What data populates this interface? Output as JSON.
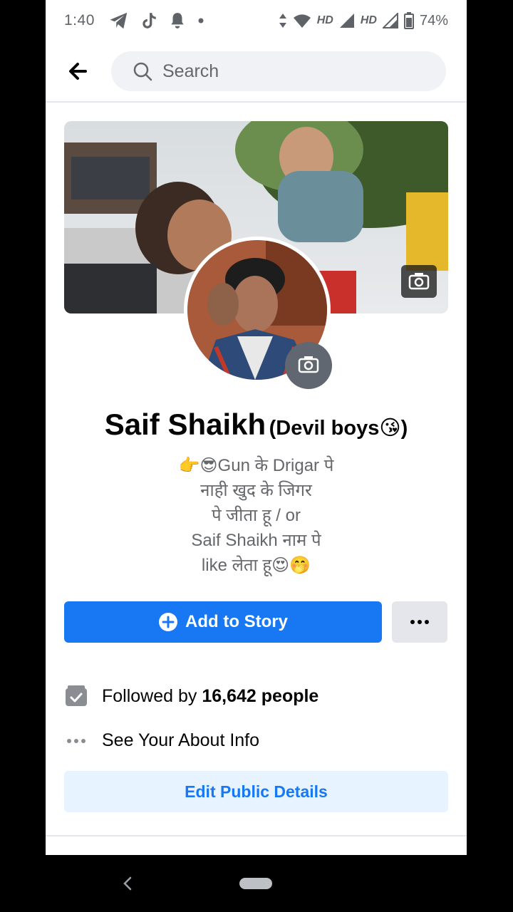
{
  "status_bar": {
    "time": "1:40",
    "hd1": "HD",
    "hd2": "HD",
    "battery": "74%"
  },
  "header": {
    "search_placeholder": "Search"
  },
  "profile": {
    "name": "Saif Shaikh",
    "alternate_name": "(Devil boys😘)",
    "bio_lines": [
      "👉😎Gun के Drigar पे",
      "नाही खुद के जिगर",
      "पे जीता हू / or",
      "Saif Shaikh नाम पे",
      "like लेता हू😍🤭"
    ]
  },
  "actions": {
    "add_story_label": "Add to Story",
    "more_label": "···"
  },
  "info": {
    "followed_prefix": "Followed by ",
    "followed_count": "16,642 people",
    "about_label": "See Your About Info"
  },
  "edit_public_details_label": "Edit Public Details",
  "colors": {
    "accent": "#1877f2",
    "accent_light": "#e7f3ff",
    "secondary_button": "#e4e6eb",
    "text_secondary": "#65676b"
  }
}
